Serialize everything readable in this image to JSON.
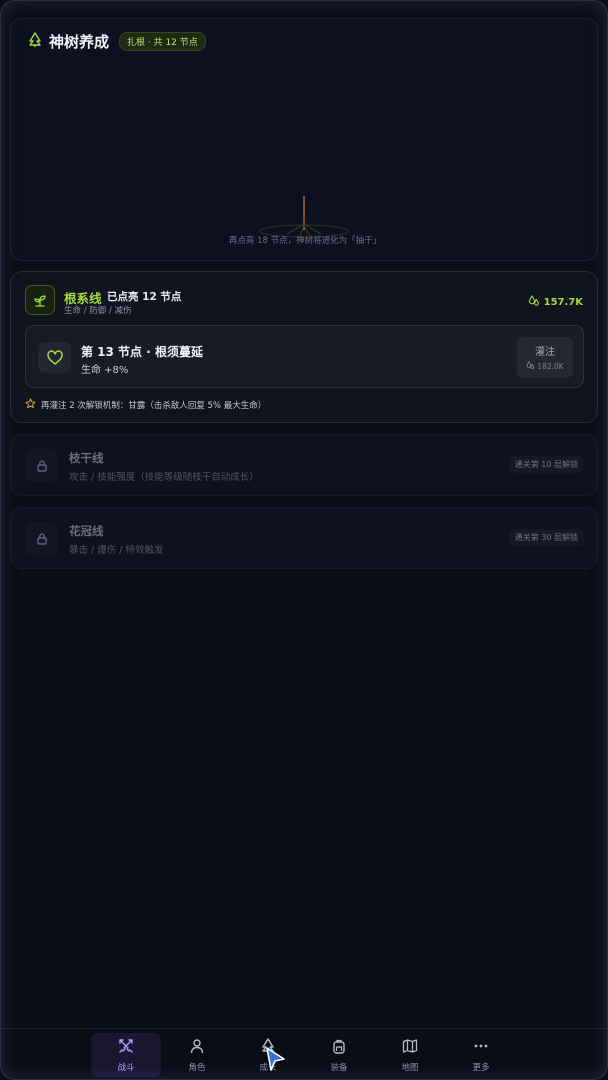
{
  "header": {
    "title": "神树养成",
    "stage_badge": "扎根 · 共 12 节点",
    "tree_hint": "再点亮 18 节点，神树将进化为「抽干」"
  },
  "root_line": {
    "name": "根系线",
    "lit_count": "已点亮 12 节点",
    "attributes": "生命 / 防御 / 减伤",
    "resource_amount": "157.7K",
    "node": {
      "title": "第 13 节点 · 根须蔓延",
      "effect": "生命 +8%",
      "pour_label": "灌注",
      "pour_cost": "182.0K"
    },
    "unlock_hint": "再灌注 2 次解锁机制：甘露（击杀敌人回复 5% 最大生命）"
  },
  "locked_lines": [
    {
      "name": "枝干线",
      "attributes": "攻击 / 技能强度（技能等级随枝干自动成长）",
      "requirement": "通关第 10 层解锁"
    },
    {
      "name": "花冠线",
      "attributes": "暴击 / 爆伤 / 特效触发",
      "requirement": "通关第 30 层解锁"
    }
  ],
  "nav": {
    "items": [
      {
        "label": "战斗",
        "icon": "crossed-swords-icon"
      },
      {
        "label": "角色",
        "icon": "user-icon"
      },
      {
        "label": "成长",
        "icon": "tree-icon"
      },
      {
        "label": "装备",
        "icon": "backpack-icon"
      },
      {
        "label": "地图",
        "icon": "map-icon"
      },
      {
        "label": "更多",
        "icon": "more-icon"
      }
    ]
  },
  "colors": {
    "accent_green": "#9fdc3e",
    "accent_purple": "#b79cff",
    "background": "#0b0d18"
  }
}
